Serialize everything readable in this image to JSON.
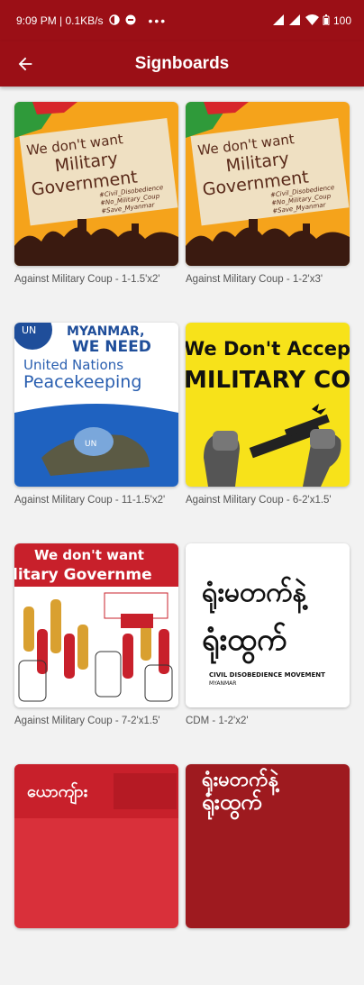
{
  "status_bar": {
    "time_info": "9:09 PM | 0.1KB/s",
    "battery": "100"
  },
  "app_bar": {
    "title": "Signboards"
  },
  "items": [
    {
      "caption": "Against Military Coup - 1-1.5'x2'",
      "poster_lines": [
        "We don't want",
        "Military",
        "Government"
      ],
      "hashtags": [
        "#Civil_Disobedience",
        "#No_Military_Coup",
        "#Save_Myanmar"
      ]
    },
    {
      "caption": "Against Military Coup - 1-2'x3'",
      "poster_lines": [
        "We don't want",
        "Military",
        "Government"
      ],
      "hashtags": [
        "#Civil_Disobedience",
        "#No_Military_Coup",
        "#Save_Myanmar"
      ]
    },
    {
      "caption": "Against Military Coup - 11-1.5'x2'",
      "poster_lines": [
        "MYANMAR,",
        "WE NEED",
        "United Nations",
        "Peacekeeping"
      ],
      "badge": "UN",
      "helmet": "UN"
    },
    {
      "caption": "Against Military Coup - 6-2'x1.5'",
      "poster_lines": [
        "We Don't Accep",
        "MILITARY COU"
      ]
    },
    {
      "caption": "Against Military Coup - 7-2'x1.5'",
      "poster_lines": [
        "We don't want",
        "litary Governme"
      ]
    },
    {
      "caption": "CDM - 1-2'x2'",
      "poster_lines": [
        "ရုံးမတက်နဲ့",
        "ရုံးထွက်"
      ],
      "subtitle": [
        "CIVIL DISOBEDIENCE MOVEMENT",
        "MYANMAR"
      ]
    },
    {
      "caption": "",
      "poster_lines": [
        "ယောကျ်ား"
      ]
    },
    {
      "caption": "",
      "poster_lines": [
        "ရုံးမတက်နဲ့",
        "ရုံးထွက်"
      ]
    }
  ]
}
